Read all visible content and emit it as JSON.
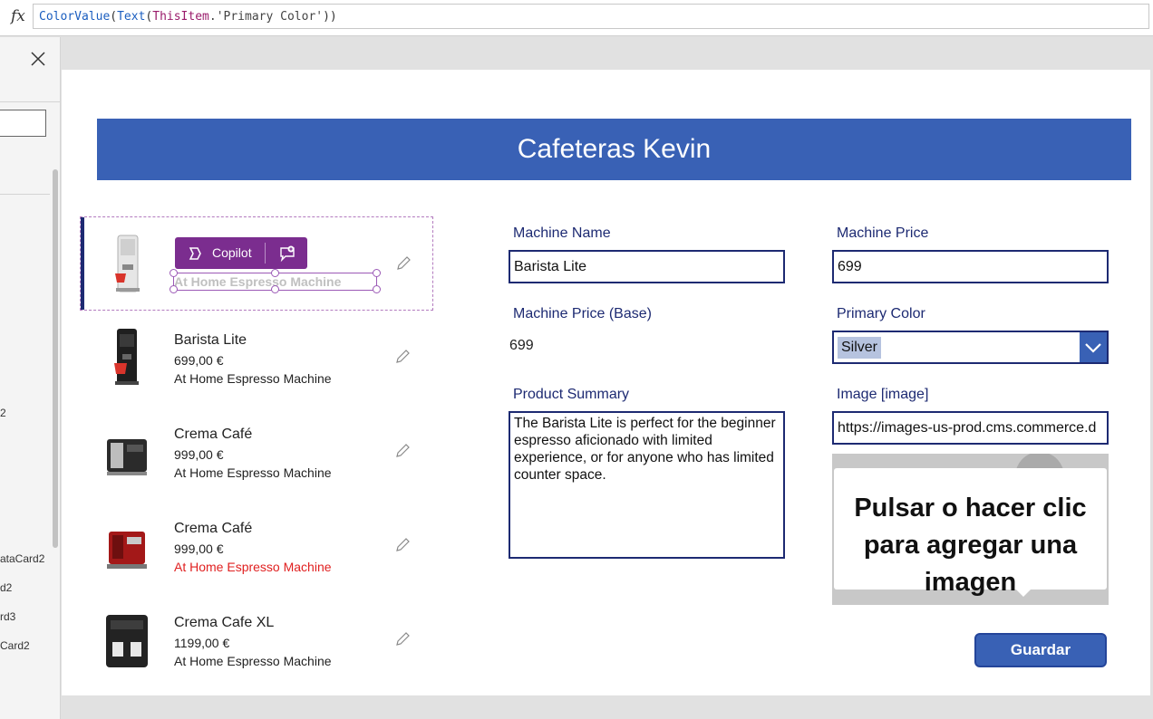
{
  "formula": {
    "fx_label": "fx",
    "tokens": [
      {
        "text": "ColorValue",
        "kind": "fn"
      },
      {
        "text": "(",
        "kind": "punc"
      },
      {
        "text": "Text",
        "kind": "fn"
      },
      {
        "text": "(",
        "kind": "punc"
      },
      {
        "text": "ThisItem",
        "kind": "prop"
      },
      {
        "text": ".'Primary Color'",
        "kind": "str"
      },
      {
        "text": "))",
        "kind": "punc"
      }
    ]
  },
  "left_panel": {
    "items": [
      "2",
      "ataCard2",
      "d2",
      "rd3",
      "Card2"
    ]
  },
  "app": {
    "header_title": "Cafeteras Kevin"
  },
  "gallery": {
    "copilot_label": "Copilot",
    "items": [
      {
        "title": "",
        "price": "",
        "subtitle": "At Home Espresso Machine",
        "subtitle_color": "#c0c0c0",
        "selected": true,
        "image": "white-espresso-machine"
      },
      {
        "title": "Barista Lite",
        "price": "699,00 €",
        "subtitle": "At Home Espresso Machine",
        "subtitle_color": "#222222",
        "selected": false,
        "image": "black-espresso-machine"
      },
      {
        "title": "Crema Café",
        "price": "999,00 €",
        "subtitle": "At Home Espresso Machine",
        "subtitle_color": "#222222",
        "selected": false,
        "image": "silver-espresso-machine"
      },
      {
        "title": "Crema Café",
        "price": "999,00 €",
        "subtitle": "At Home Espresso Machine",
        "subtitle_color": "#e02020",
        "selected": false,
        "image": "red-espresso-machine"
      },
      {
        "title": "Crema Cafe XL",
        "price": "1199,00 €",
        "subtitle": "At Home Espresso Machine",
        "subtitle_color": "#222222",
        "selected": false,
        "image": "black-double-espresso-machine"
      }
    ]
  },
  "form": {
    "machine_name_label": "Machine Name",
    "machine_name_value": "Barista Lite",
    "machine_price_label": "Machine Price",
    "machine_price_value": "699",
    "base_price_label": "Machine Price (Base)",
    "base_price_value": "699",
    "primary_color_label": "Primary Color",
    "primary_color_value": "Silver",
    "summary_label": "Product Summary",
    "summary_value": "The Barista Lite is perfect for the beginner espresso aficionado with limited experience, or for anyone who has limited counter space.",
    "image_label": "Image [image]",
    "image_value": "https://images-us-prod.cms.commerce.d",
    "image_placeholder_text": "Pulsar o hacer clic para agregar una imagen",
    "save_label": "Guardar"
  },
  "colors": {
    "header_bg": "#3961b5",
    "accent_dark": "#1d2a72",
    "copilot_purple": "#7b2d8f"
  }
}
